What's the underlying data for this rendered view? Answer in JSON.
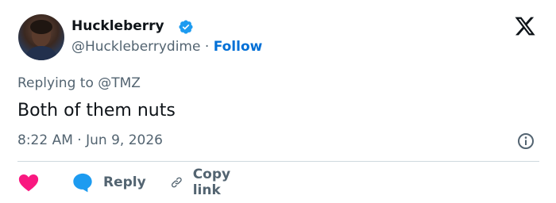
{
  "author": {
    "name": "Huckleberry",
    "handle": "@Huckleberrydime",
    "separator": "·",
    "follow_label": "Follow"
  },
  "tweet": {
    "replying_to_prefix": "Replying to",
    "replying_to_handle": "@TMZ",
    "text": "Both of them nuts",
    "time": "8:22 AM",
    "date_separator": "·",
    "date": "Jun 9, 2026"
  },
  "actions": {
    "reply_label": "Reply",
    "copy_link_label": "Copy link"
  },
  "colors": {
    "like": "#f91880",
    "reply": "#1d9bf0",
    "verified": "#1d9bf0",
    "link": "#006fd6",
    "muted": "#536471"
  },
  "icons": {
    "like": "heart-icon",
    "reply": "speech-bubble-icon",
    "copy_link": "link-icon",
    "info": "info-icon",
    "brand": "x-logo-icon",
    "verified": "verified-badge-icon"
  }
}
